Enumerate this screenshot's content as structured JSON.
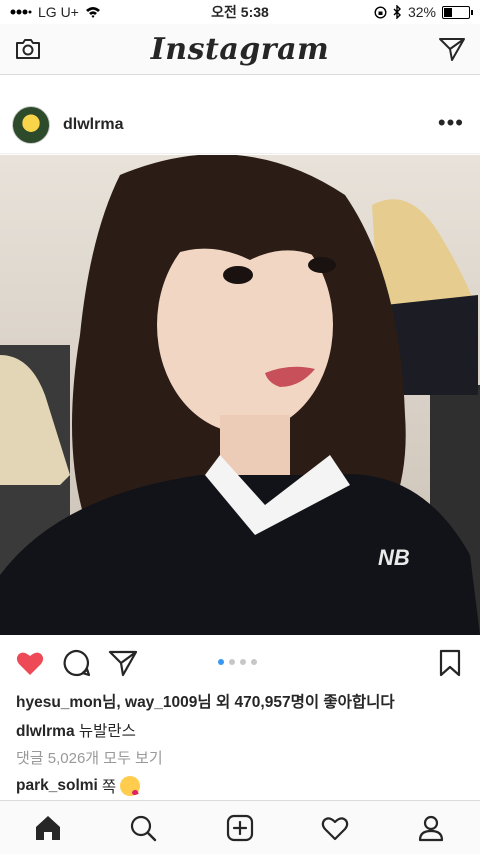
{
  "status_bar": {
    "carrier": "LG U+",
    "time": "오전 5:38",
    "battery": "32%",
    "battery_level": 0.32
  },
  "top_bar": {
    "logo": "Instagram",
    "left_icon": "camera-icon",
    "right_icon": "direct-message-icon"
  },
  "post": {
    "username": "dlwlrma",
    "more_icon": "more-options-icon",
    "carousel_total": 4,
    "carousel_active": 1,
    "likes_text": "hyesu_mon님, way_1009님 외 470,957명이 좋아합니다",
    "caption_user": "dlwlrma",
    "caption_text": "뉴발란스",
    "view_comments": "댓글 5,026개 모두 보기",
    "comment_user": "park_solmi",
    "comment_text": "쪽",
    "comment_emoji": "kissing-face-emoji",
    "colors": {
      "like": "#ed4956",
      "dot_active": "#3897f0"
    }
  },
  "tab_bar": {
    "items": [
      "home-icon",
      "search-icon",
      "new-post-icon",
      "activity-icon",
      "profile-icon"
    ]
  }
}
